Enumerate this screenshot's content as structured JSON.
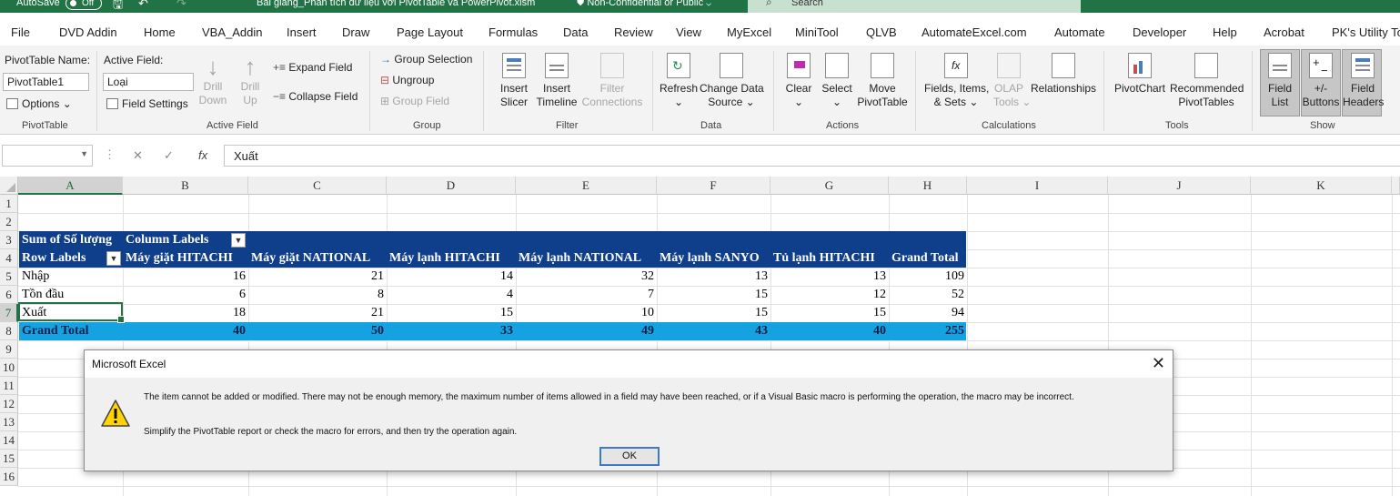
{
  "titlebar": {
    "autosave_label": "AutoSave",
    "autosave_state": "Off",
    "document_title": "Bài giảng_Phân tích dữ liệu với PivotTable và PowerPivot.xlsm",
    "sensitivity": "Non-Confidential or Public",
    "search_placeholder": "Search",
    "accent_color": "#217346"
  },
  "menu_tabs": [
    "File",
    "DVD Addin",
    "Home",
    "VBA_Addin",
    "Insert",
    "Draw",
    "Page Layout",
    "Formulas",
    "Data",
    "Review",
    "View",
    "MyExcel",
    "MiniTool",
    "QLVB",
    "AutomateExcel.com",
    "Automate",
    "Developer",
    "Help",
    "Acrobat",
    "PK's Utility To"
  ],
  "ribbon": {
    "pivottable": {
      "name_label": "PivotTable Name:",
      "name_value": "PivotTable1",
      "options": "Options",
      "group": "PivotTable"
    },
    "active_field": {
      "label": "Active Field:",
      "value": "Loại",
      "field_settings": "Field Settings",
      "drill_down": [
        "Drill",
        "Down"
      ],
      "drill_up": [
        "Drill",
        "Up"
      ],
      "expand": "Expand Field",
      "collapse": "Collapse Field",
      "group": "Active Field"
    },
    "group_grp": {
      "group_selection": "Group Selection",
      "ungroup": "Ungroup",
      "group_field": "Group Field",
      "group": "Group"
    },
    "filter": {
      "insert_slicer": [
        "Insert",
        "Slicer"
      ],
      "insert_timeline": [
        "Insert",
        "Timeline"
      ],
      "filter_connections": [
        "Filter",
        "Connections"
      ],
      "group": "Filter"
    },
    "data": {
      "refresh": "Refresh",
      "change_source": [
        "Change Data",
        "Source"
      ],
      "group": "Data"
    },
    "actions": {
      "clear": "Clear",
      "select": "Select",
      "move": [
        "Move",
        "PivotTable"
      ],
      "group": "Actions"
    },
    "calculations": {
      "fields_items": [
        "Fields, Items,",
        "& Sets"
      ],
      "olap_tools": [
        "OLAP",
        "Tools"
      ],
      "relationships": "Relationships",
      "group": "Calculations"
    },
    "tools": {
      "pivotchart": "PivotChart",
      "recommended": [
        "Recommended",
        "PivotTables"
      ],
      "group": "Tools"
    },
    "show": {
      "field_list": [
        "Field",
        "List"
      ],
      "buttons": [
        "+/-",
        "Buttons"
      ],
      "field_headers": [
        "Field",
        "Headers"
      ],
      "group": "Show"
    }
  },
  "formula_bar": {
    "name_box": "",
    "content": "Xuất"
  },
  "grid": {
    "columns": [
      "A",
      "B",
      "C",
      "D",
      "E",
      "F",
      "G",
      "H",
      "I",
      "J",
      "K"
    ],
    "rows": [
      "1",
      "2",
      "3",
      "4",
      "5",
      "6",
      "7",
      "8",
      "9",
      "10",
      "11",
      "12",
      "13",
      "14",
      "15",
      "16"
    ],
    "active_cell": "A7"
  },
  "pivot": {
    "values_label": "Sum of Số lượng",
    "column_labels": "Column Labels",
    "row_labels": "Row Labels",
    "headers": [
      "Máy giặt HITACHI",
      "Máy giặt NATIONAL",
      "Máy lạnh HITACHI",
      "Máy lạnh NATIONAL",
      "Máy lạnh SANYO",
      "Tủ lạnh HITACHI",
      "Grand Total"
    ],
    "rows": [
      {
        "label": "Nhập",
        "values": [
          "16",
          "21",
          "14",
          "32",
          "13",
          "13",
          "109"
        ]
      },
      {
        "label": "Tồn đầu",
        "values": [
          "6",
          "8",
          "4",
          "7",
          "15",
          "12",
          "52"
        ]
      },
      {
        "label": "Xuất",
        "values": [
          "18",
          "21",
          "15",
          "10",
          "15",
          "15",
          "94"
        ]
      }
    ],
    "grand_total": {
      "label": "Grand Total",
      "values": [
        "40",
        "50",
        "33",
        "49",
        "43",
        "40",
        "255"
      ]
    },
    "header_color": "#0f3e8a",
    "total_color": "#14a3e0"
  },
  "dialog": {
    "title": "Microsoft Excel",
    "message": "The item cannot be added or modified. There may not be enough memory, the maximum number of items allowed in a field may have been reached, or if a Visual Basic macro is performing the operation, the macro may be incorrect.",
    "message2": "Simplify the PivotTable report or check the macro for errors, and then try the operation again.",
    "ok": "OK"
  }
}
